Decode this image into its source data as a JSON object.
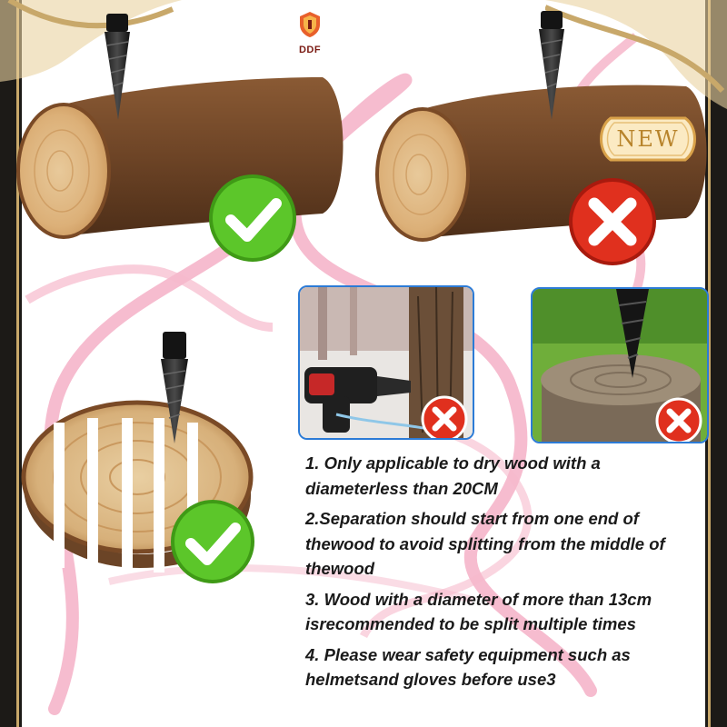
{
  "brand": {
    "name": "DDF"
  },
  "badge": {
    "label": "NEW"
  },
  "notes": [
    "1. Only applicable to dry wood with a diameterless than 20CM",
    "2.Separation should start from one end of thewood to avoid splitting from the middle of thewood",
    "3. Wood with a diameter of more than 13cm isrecommended to be split multiple times",
    "4. Please wear safety equipment such as helmetsand gloves before use3"
  ],
  "colors": {
    "check_green": "#5cc62a",
    "cross_red": "#e0301e",
    "ribbon_pink": "#f3a6bf",
    "frame_gold": "#c8a86a",
    "photo_border": "#2c7bd6"
  },
  "illustrations": [
    {
      "name": "log-end-drill",
      "status": "correct"
    },
    {
      "name": "log-middle-drill",
      "status": "incorrect"
    },
    {
      "name": "handheld-drill-standing-tree",
      "status": "incorrect"
    },
    {
      "name": "tree-stump-drill",
      "status": "incorrect"
    },
    {
      "name": "wood-slice-drill",
      "status": "correct"
    }
  ]
}
